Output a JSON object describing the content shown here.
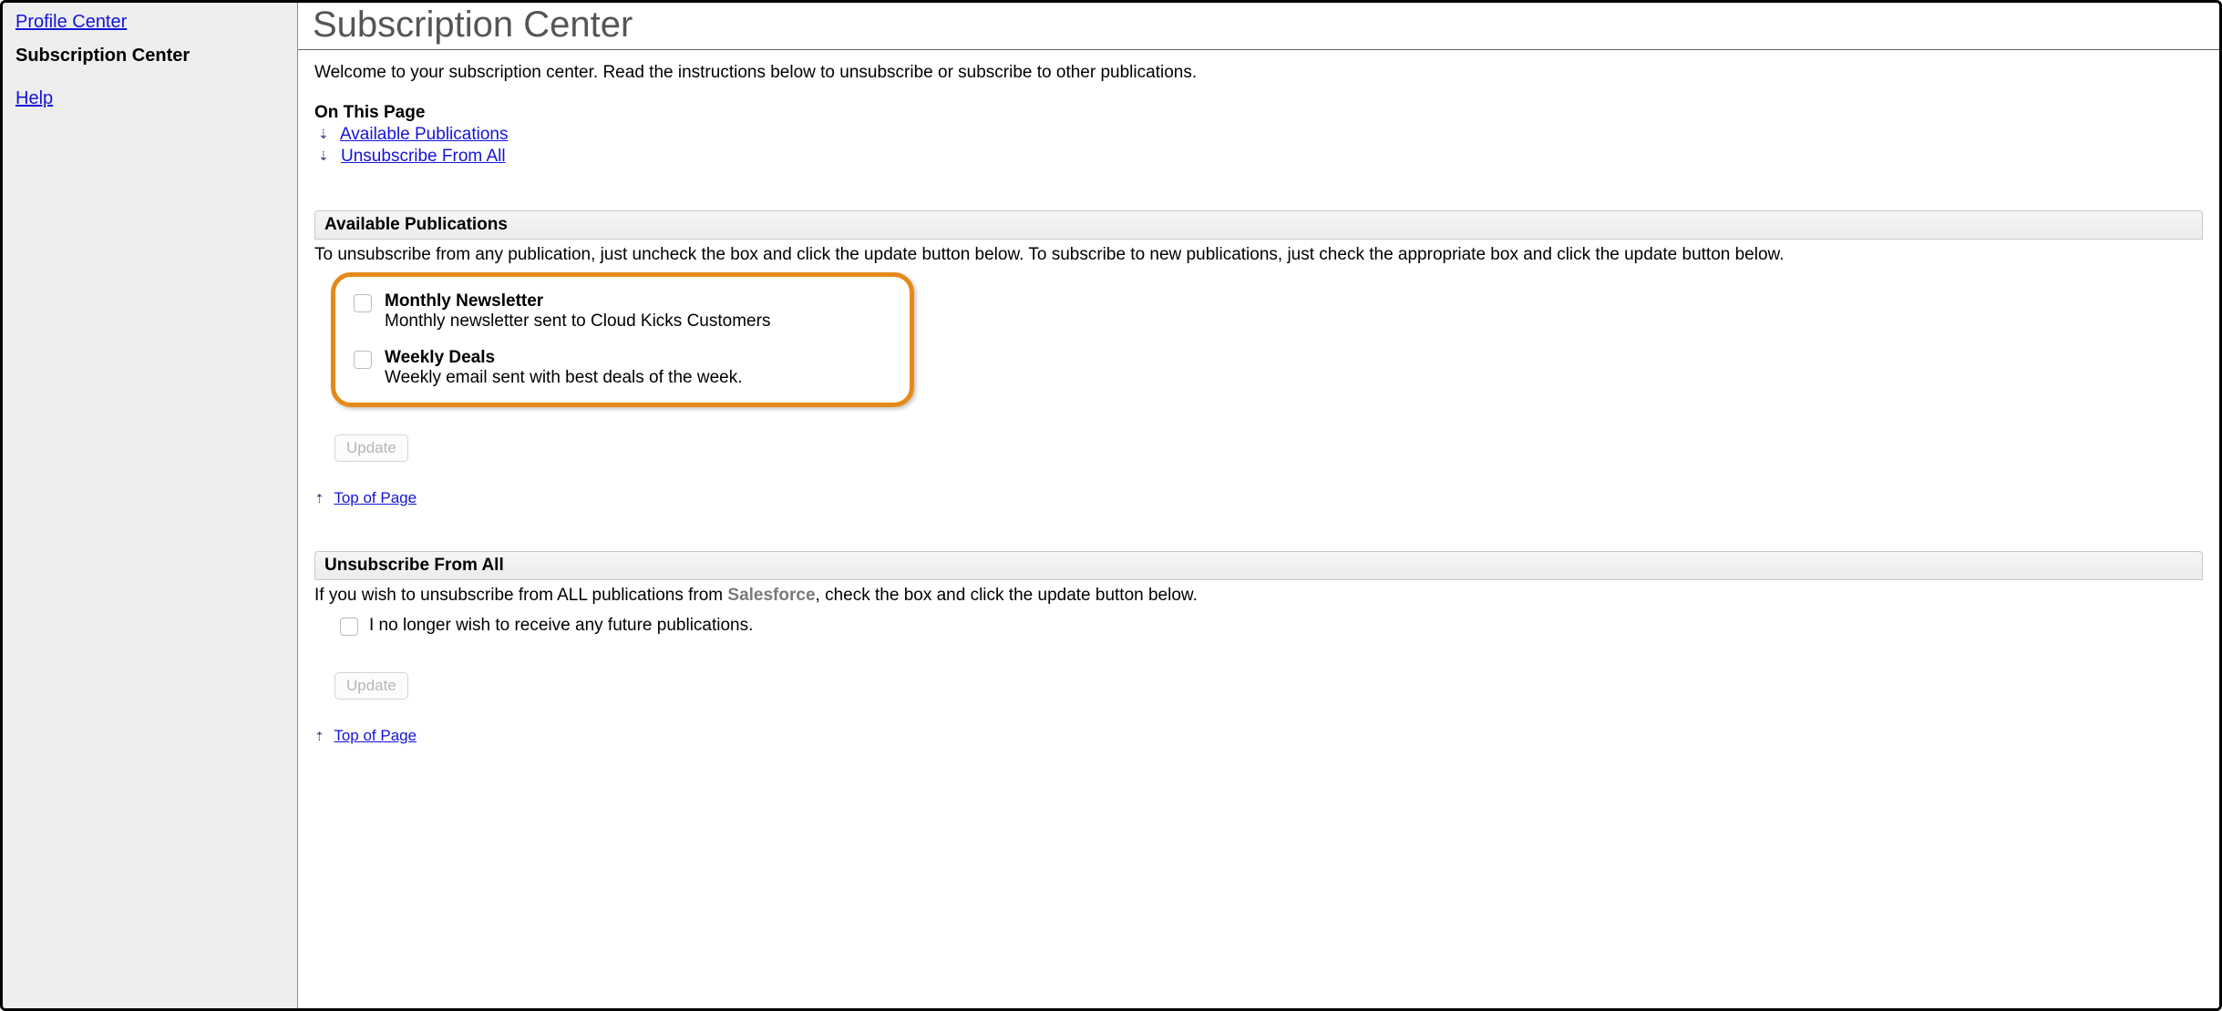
{
  "sidebar": {
    "items": [
      {
        "label": "Profile Center",
        "active": false
      },
      {
        "label": "Subscription Center",
        "active": true
      },
      {
        "label": "Help",
        "active": false
      }
    ]
  },
  "page": {
    "title": "Subscription Center",
    "welcome": "Welcome to your subscription center. Read the instructions below to unsubscribe or subscribe to other publications.",
    "on_this_page_label": "On This Page",
    "nav": {
      "available_publications": "Available Publications",
      "unsubscribe_from_all": "Unsubscribe From All"
    },
    "top_of_page": "Top of Page"
  },
  "available": {
    "header": "Available Publications",
    "instructions": "To unsubscribe from any publication, just uncheck the box and click the update button below. To subscribe to new publications, just check the appropriate box and click the update button below.",
    "publications": [
      {
        "title": "Monthly Newsletter",
        "description": "Monthly newsletter sent to Cloud Kicks Customers"
      },
      {
        "title": "Weekly Deals",
        "description": "Weekly email sent with best deals of the week."
      }
    ],
    "update_label": "Update"
  },
  "unsubscribe": {
    "header": "Unsubscribe From All",
    "instructions_prefix": "If you wish to unsubscribe from ALL publications from ",
    "org_name": "Salesforce",
    "instructions_suffix": ", check the box and click the update button below.",
    "checkbox_label": "I no longer wish to receive any future publications.",
    "update_label": "Update"
  }
}
